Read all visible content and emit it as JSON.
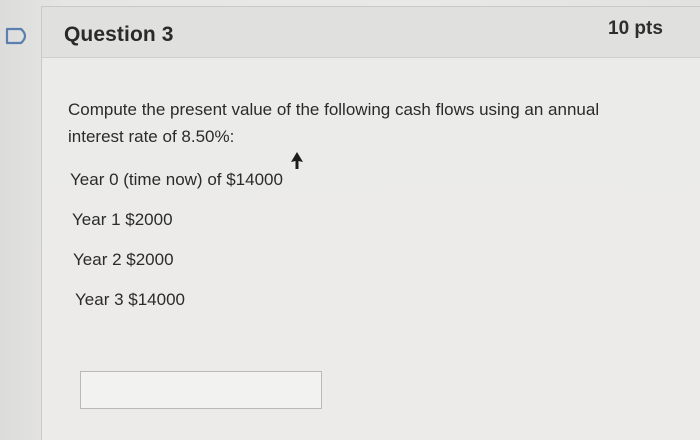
{
  "question": {
    "title": "Question 3",
    "points": "10 pts",
    "prompt": "Compute the present value of the following cash flows using an annual interest rate of 8.50%:",
    "cash_flows": [
      "Year 0 (time now) of $14000",
      "Year 1 $2000",
      "Year 2 $2000",
      "Year 3 $14000"
    ],
    "answer_value": ""
  },
  "icons": {
    "flag": "flag-icon",
    "cursor": "mouse-pointer-icon"
  },
  "colors": {
    "flag_stroke": "#5a7fb0",
    "text": "#2b2b2b",
    "header_bg": "#e0e0de"
  }
}
